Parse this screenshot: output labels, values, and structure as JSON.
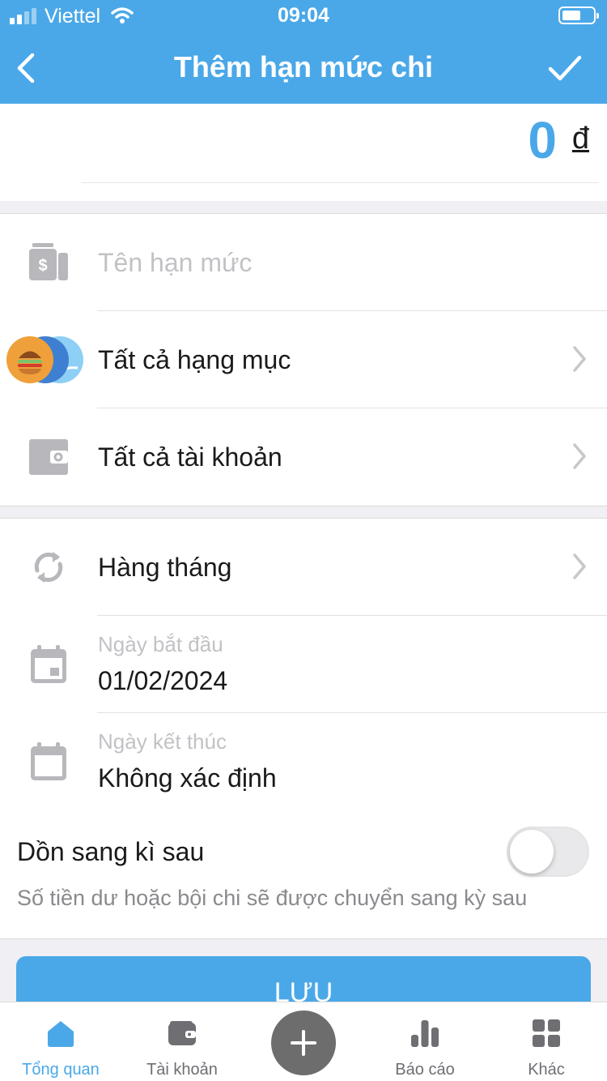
{
  "status_bar": {
    "carrier": "Viettel",
    "time": "09:04"
  },
  "header": {
    "title": "Thêm hạn mức chi",
    "back_icon": "chevron-left-icon",
    "confirm_icon": "checkmark-icon"
  },
  "amount": {
    "value": "0",
    "currency": "đ"
  },
  "form": {
    "name_placeholder": "Tên hạn mức",
    "category": "Tất cả hạng mục",
    "account": "Tất cả tài khoản",
    "repeat": "Hàng tháng",
    "start_date_label": "Ngày bắt đầu",
    "start_date_value": "01/02/2024",
    "end_date_label": "Ngày kết thúc",
    "end_date_value": "Không xác định"
  },
  "carry_over": {
    "title": "Dồn sang kì sau",
    "description": "Số tiền dư hoặc bội chi sẽ được chuyển sang kỳ sau",
    "enabled": false
  },
  "save_button": {
    "label": "LƯU"
  },
  "tab_bar": {
    "tabs": [
      {
        "label": "Tổng quan",
        "icon": "home-icon",
        "active": true
      },
      {
        "label": "Tài khoản",
        "icon": "wallet-icon",
        "active": false
      },
      {
        "label": "",
        "icon": "plus-icon",
        "active": false
      },
      {
        "label": "Báo cáo",
        "icon": "bar-chart-icon",
        "active": false
      },
      {
        "label": "Khác",
        "icon": "grid-icon",
        "active": false
      }
    ]
  },
  "colors": {
    "primary": "#4aa8e8",
    "icon_gray": "#b7b7bc",
    "fab": "#6d6d6d"
  }
}
